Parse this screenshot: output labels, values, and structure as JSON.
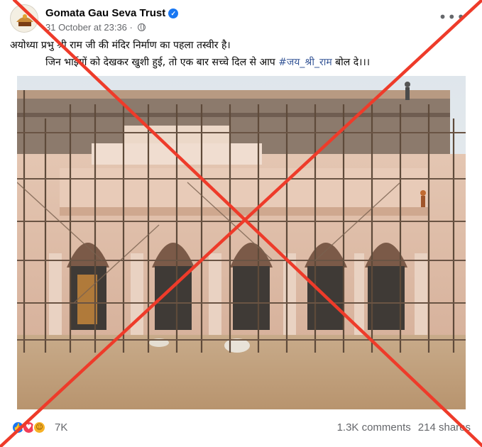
{
  "post": {
    "page_name": "Gomata Gau Seva Trust",
    "timestamp": "31 October at 23:36",
    "caption_line1": "अयोध्या प्रभु श्री राम जी की मंदिर निर्माण का पहला तस्वीर है।",
    "caption_line2_prefix": "जिन भाईयों को देखकर खुशी हुई, तो एक बार सच्चे दिल से आप ",
    "caption_hashtag": "#जय_श्री_राम",
    "caption_line2_suffix": " बोल दे।।।",
    "more_icon": "•••"
  },
  "footer": {
    "reactions": [
      "like-icon",
      "love-icon",
      "care-icon"
    ],
    "reaction_count": "7K",
    "comments": "1.3K comments",
    "shares": "214 shares"
  },
  "colors": {
    "verified": "#1877f2",
    "hashtag": "#385898",
    "cross": "#ee3b2a",
    "meta_text": "#65676b"
  }
}
